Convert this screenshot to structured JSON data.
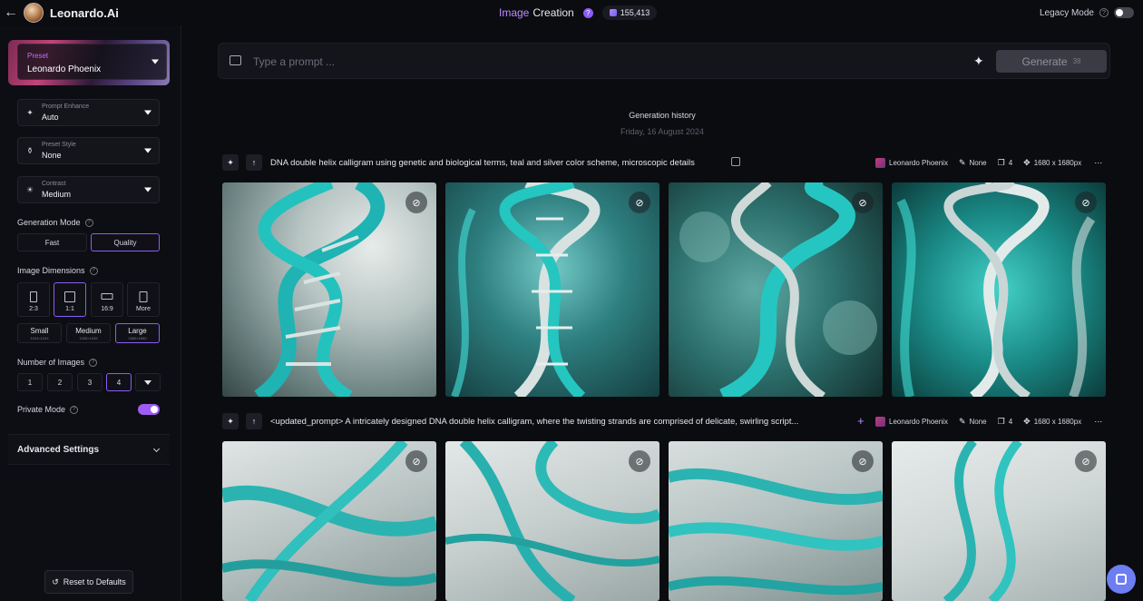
{
  "app": {
    "brand": "Leonardo.Ai"
  },
  "header": {
    "title_accent": "Image",
    "title_rest": "Creation",
    "tokens": "155,413",
    "legacy_mode_label": "Legacy Mode"
  },
  "sidebar": {
    "preset": {
      "label": "Preset",
      "value": "Leonardo Phoenix"
    },
    "prompt_enhance": {
      "label": "Prompt Enhance",
      "value": "Auto"
    },
    "preset_style": {
      "label": "Preset Style",
      "value": "None"
    },
    "contrast": {
      "label": "Contrast",
      "value": "Medium"
    },
    "generation_mode": {
      "label": "Generation Mode",
      "options": [
        "Fast",
        "Quality"
      ],
      "selected": "Quality"
    },
    "image_dimensions": {
      "label": "Image Dimensions",
      "ratios": [
        "2:3",
        "1:1",
        "16:9",
        "More"
      ],
      "selected_ratio": "1:1",
      "sizes": [
        {
          "name": "Small",
          "res": "1024×1024"
        },
        {
          "name": "Medium",
          "res": "1536×1536"
        },
        {
          "name": "Large",
          "res": "1680×1680"
        }
      ],
      "selected_size": "Large"
    },
    "number_of_images": {
      "label": "Number of Images",
      "options": [
        "1",
        "2",
        "3",
        "4"
      ],
      "selected": "4"
    },
    "private_mode": {
      "label": "Private Mode",
      "on": true
    },
    "advanced_settings": "Advanced Settings",
    "reset": "Reset to Defaults"
  },
  "main": {
    "prompt_placeholder": "Type a prompt ...",
    "generate_label": "Generate",
    "generate_cost": "38",
    "history_title": "Generation history",
    "history_date": "Friday, 16 August 2024",
    "generations": [
      {
        "prompt": "DNA double helix calligram using genetic and biological terms, teal and silver color scheme, microscopic details",
        "model": "Leonardo Phoenix",
        "style": "None",
        "count": "4",
        "size": "1680 x 1680px"
      },
      {
        "prompt": "<updated_prompt> A intricately designed DNA double helix calligram, where the twisting strands are comprised of delicate, swirling script...",
        "model": "Leonardo Phoenix",
        "style": "None",
        "count": "4",
        "size": "1680 x 1680px"
      }
    ]
  },
  "colors": {
    "accent": "#8b5cf6",
    "teal": "#2bb3b1",
    "bg": "#0b0c10"
  }
}
